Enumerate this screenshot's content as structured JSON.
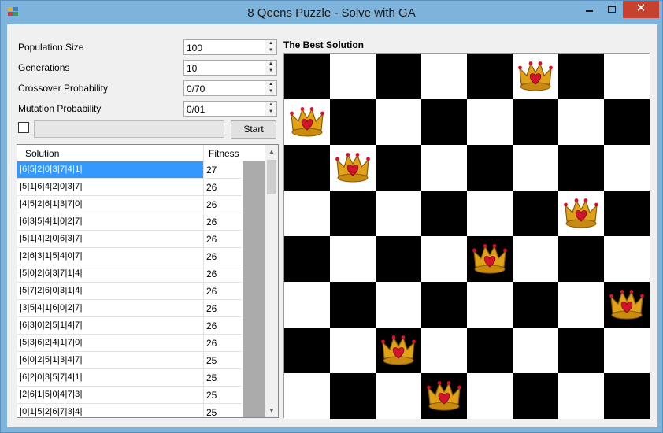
{
  "window": {
    "title": "8 Qeens Puzzle - Solve with GA",
    "controls": {
      "minimize": "–",
      "maximize": "□",
      "close": "✕"
    }
  },
  "params": {
    "population": {
      "label": "Population Size",
      "value": "100"
    },
    "generations": {
      "label": "Generations",
      "value": "10"
    },
    "crossover": {
      "label": "Crossover Probability",
      "value": "0/70"
    },
    "mutation": {
      "label": "Mutation Probability",
      "value": "0/01"
    }
  },
  "progress": {
    "fraction": 0
  },
  "start_label": "Start",
  "table": {
    "headers": {
      "solution": "Solution",
      "fitness": "Fitness"
    },
    "rows": [
      {
        "solution": "|6|5|2|0|3|7|4|1|",
        "fitness": "27"
      },
      {
        "solution": "|5|1|6|4|2|0|3|7|",
        "fitness": "26"
      },
      {
        "solution": "|4|5|2|6|1|3|7|0|",
        "fitness": "26"
      },
      {
        "solution": "|6|3|5|4|1|0|2|7|",
        "fitness": "26"
      },
      {
        "solution": "|5|1|4|2|0|6|3|7|",
        "fitness": "26"
      },
      {
        "solution": "|2|6|3|1|5|4|0|7|",
        "fitness": "26"
      },
      {
        "solution": "|5|0|2|6|3|7|1|4|",
        "fitness": "26"
      },
      {
        "solution": "|5|7|2|6|0|3|1|4|",
        "fitness": "26"
      },
      {
        "solution": "|3|5|4|1|6|0|2|7|",
        "fitness": "26"
      },
      {
        "solution": "|6|3|0|2|5|1|4|7|",
        "fitness": "26"
      },
      {
        "solution": "|5|3|6|2|4|1|7|0|",
        "fitness": "26"
      },
      {
        "solution": "|6|0|2|5|1|3|4|7|",
        "fitness": "25"
      },
      {
        "solution": "|6|2|0|3|5|7|4|1|",
        "fitness": "25"
      },
      {
        "solution": "|2|6|1|5|0|4|7|3|",
        "fitness": "25"
      },
      {
        "solution": "|0|1|5|2|6|7|3|4|",
        "fitness": "25"
      }
    ]
  },
  "board": {
    "title": "The Best Solution",
    "queen_rows_by_column": [
      1,
      2,
      6,
      7,
      4,
      0,
      3,
      5
    ],
    "queen_icon": "crown-heart-icon",
    "colors": {
      "dark": "#000000",
      "light": "#ffffff",
      "crown": "#e0a216",
      "heart": "#d2142c"
    }
  }
}
